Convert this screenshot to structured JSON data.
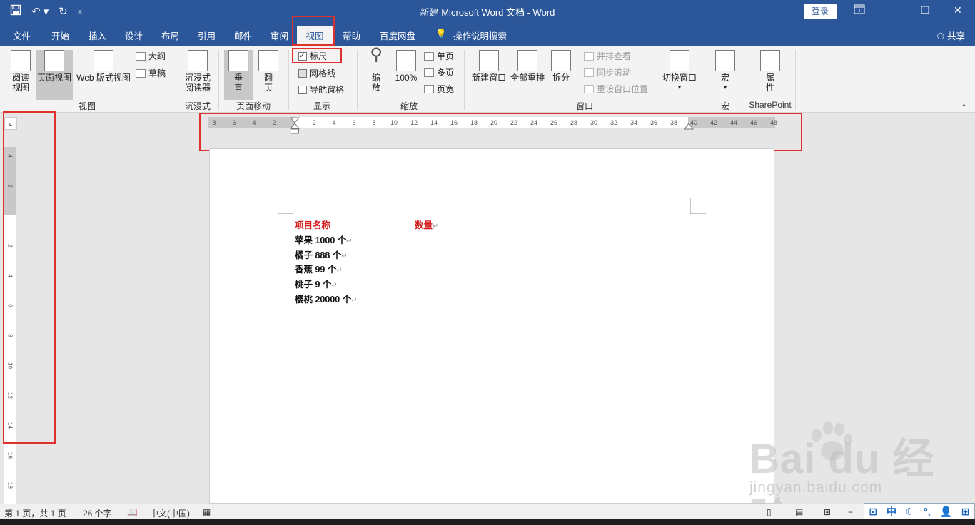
{
  "window": {
    "title": "新建 Microsoft Word 文档  -  Word",
    "login_label": "登录",
    "qat_icons": [
      "save-icon",
      "undo-icon",
      "redo-icon",
      "customize-icon"
    ]
  },
  "tabs": [
    {
      "label": "文件"
    },
    {
      "label": "开始"
    },
    {
      "label": "插入"
    },
    {
      "label": "设计"
    },
    {
      "label": "布局"
    },
    {
      "label": "引用"
    },
    {
      "label": "邮件"
    },
    {
      "label": "审阅"
    },
    {
      "label": "视图",
      "active": true
    },
    {
      "label": "帮助"
    },
    {
      "label": "百度网盘"
    },
    {
      "label": "操作说明搜索"
    }
  ],
  "share_label": "共享",
  "ribbon": {
    "views": {
      "group_label": "视图",
      "read_mode": "阅读\n视图",
      "read_mode_l1": "阅读",
      "read_mode_l2": "视图",
      "print_layout": "页面视图",
      "web_layout": "Web 版式视图",
      "outline": "大纲",
      "draft": "草稿"
    },
    "immersive": {
      "group_label": "沉浸式",
      "reader_l1": "沉浸式",
      "reader_l2": "阅读器"
    },
    "page_movement": {
      "group_label": "页面移动",
      "vertical_l1": "垂",
      "vertical_l2": "直",
      "side_l1": "翻",
      "side_l2": "页"
    },
    "show": {
      "group_label": "显示",
      "ruler": {
        "label": "标尺",
        "checked": true
      },
      "gridlines": {
        "label": "网格线",
        "checked": false
      },
      "nav_pane": {
        "label": "导航窗格",
        "checked": false
      }
    },
    "zoom": {
      "group_label": "缩放",
      "zoom_l1": "缩",
      "zoom_l2": "放",
      "hundred": "100%",
      "one_page": "单页",
      "multi_page": "多页",
      "page_width": "页宽"
    },
    "window": {
      "group_label": "窗口",
      "new_window": "新建窗口",
      "arrange_all": "全部重排",
      "split": "拆分",
      "side_by_side": "并排查看",
      "sync_scroll": "同步滚动",
      "reset_position": "重设窗口位置",
      "switch_windows": "切换窗口"
    },
    "macros": {
      "group_label": "宏",
      "macros": "宏"
    },
    "sharepoint": {
      "group_label": "SharePoint",
      "properties_l1": "属",
      "properties_l2": "性"
    }
  },
  "ruler": {
    "horizontal_ticks": [
      "8",
      "6",
      "4",
      "2",
      "",
      "2",
      "4",
      "6",
      "8",
      "10",
      "12",
      "14",
      "16",
      "18",
      "20",
      "22",
      "24",
      "26",
      "28",
      "30",
      "32",
      "34",
      "36",
      "38",
      "40",
      "42",
      "44",
      "46",
      "48"
    ],
    "vertical_ticks": [
      "4",
      "2",
      "",
      "2",
      "4",
      "6",
      "8",
      "10",
      "12",
      "14",
      "16",
      "18"
    ]
  },
  "document": {
    "header": {
      "col1": "项目名称",
      "col2": "数量"
    },
    "lines": [
      "苹果 1000 个",
      "橘子 888 个",
      "香蕉 99 个",
      "桃子 9 个",
      "樱桃 20000 个"
    ],
    "para_mark": "↵"
  },
  "statusbar": {
    "page": "第 1 页，共 1 页",
    "words": "26 个字",
    "language": "中文(中国)"
  },
  "ime": {
    "mode": "中"
  },
  "watermark": {
    "brand": "Bai du 经验",
    "url": "jingyan.baidu.com"
  }
}
